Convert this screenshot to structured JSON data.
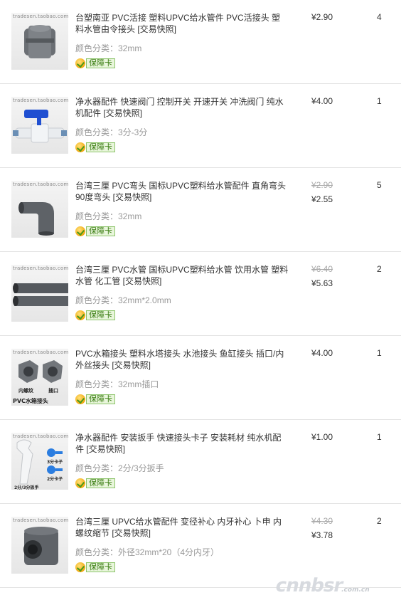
{
  "items": [
    {
      "title": "台塑南亚 PVC活接 塑料UPVC给水管件 PVC活接头 塑料水管由令接头 [交易快照]",
      "spec": "颜色分类：32mm",
      "badge": "保障卡",
      "price_old": "",
      "price": "¥2.90",
      "qty": "4",
      "watermark": "tradesen.taobao.com"
    },
    {
      "title": "净水器配件 快速阀门 控制开关 开速开关 冲洗阀门 纯水机配件 [交易快照]",
      "spec": "颜色分类：3分-3分",
      "badge": "保障卡",
      "price_old": "",
      "price": "¥4.00",
      "qty": "1",
      "watermark": "tradesen.taobao.com"
    },
    {
      "title": "台湾三厘 PVC弯头 国标UPVC塑料给水管配件 直角弯头 90度弯头 [交易快照]",
      "spec": "颜色分类：32mm",
      "badge": "保障卡",
      "price_old": "¥2.90",
      "price": "¥2.55",
      "qty": "5",
      "watermark": "tradesen.taobao.com"
    },
    {
      "title": "台湾三厘 PVC水管 国标UPVC塑料给水管 饮用水管 塑料水管 化工管 [交易快照]",
      "spec": "颜色分类：32mm*2.0mm",
      "badge": "保障卡",
      "price_old": "¥6.40",
      "price": "¥5.63",
      "qty": "2",
      "watermark": "tradesen.taobao.com"
    },
    {
      "title": "PVC水箱接头 塑料水塔接头 水池接头 鱼缸接头 插口/内外丝接头 [交易快照]",
      "spec": "颜色分类：32mm插口",
      "badge": "保障卡",
      "price_old": "",
      "price": "¥4.00",
      "qty": "1",
      "watermark": "tradesen.taobao.com",
      "img_labels": [
        "内螺纹",
        "插口",
        "PVC水箱接头"
      ]
    },
    {
      "title": "净水器配件 安装扳手 快速接头卡子 安装耗材 纯水机配件 [交易快照]",
      "spec": "颜色分类：2分/3分扳手",
      "badge": "保障卡",
      "price_old": "",
      "price": "¥1.00",
      "qty": "1",
      "watermark": "tradesen.taobao.com",
      "img_labels": [
        "3分卡子",
        "2分卡子",
        "2分/3分扳手"
      ]
    },
    {
      "title": "台湾三厘 UPVC给水管配件 变径补心 内牙补心 卜申 内螺纹缩节 [交易快照]",
      "spec": "颜色分类：外径32mm*20（4分内牙）",
      "badge": "保障卡",
      "price_old": "¥4.30",
      "price": "¥3.78",
      "qty": "2",
      "watermark": "tradesen.taobao.com"
    }
  ],
  "site_watermark": {
    "main": "cnnbsr",
    "sub": ".com.cn"
  }
}
